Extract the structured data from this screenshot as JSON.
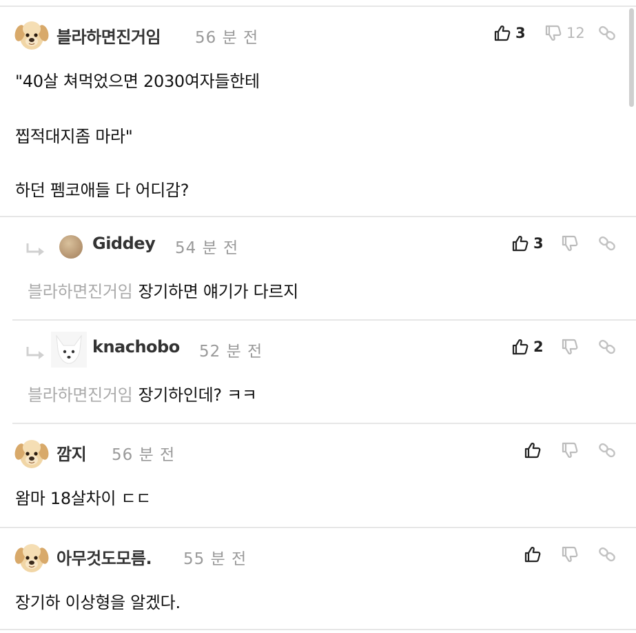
{
  "comments": [
    {
      "nick": "블라하면진거임",
      "time": "56 분 전",
      "avatar": "dog-avatar",
      "likes": "3",
      "dislikes": "12",
      "lines": [
        "\"40살 쳐먹었으면 2030여자들한테",
        "찝적대지좀 마라\"",
        "하던 펨코애들 다 어디감?"
      ]
    },
    {
      "nick": "Giddey",
      "time": "54 분 전",
      "avatar": "circle-avatar",
      "likes": "3",
      "dislikes": "",
      "mention": "블라하면진거임",
      "text": "장기하면 얘기가 다르지"
    },
    {
      "nick": "knachobo",
      "time": "52 분 전",
      "avatar": "fox-avatar",
      "likes": "2",
      "dislikes": "",
      "mention": "블라하면진거임",
      "text": "장기하인데? ㅋㅋ"
    },
    {
      "nick": "깜지",
      "time": "56 분 전",
      "avatar": "dog-avatar",
      "likes": "",
      "dislikes": "",
      "text": "왐마 18살차이 ㄷㄷ"
    },
    {
      "nick": "아무것도모름.",
      "time": "55 분 전",
      "avatar": "dog-avatar",
      "likes": "",
      "dislikes": "",
      "text": "장기하 이상형을 알겠다."
    }
  ],
  "colors": {
    "separator": "#e6e6e6",
    "muted": "#999999",
    "text": "#111111"
  }
}
